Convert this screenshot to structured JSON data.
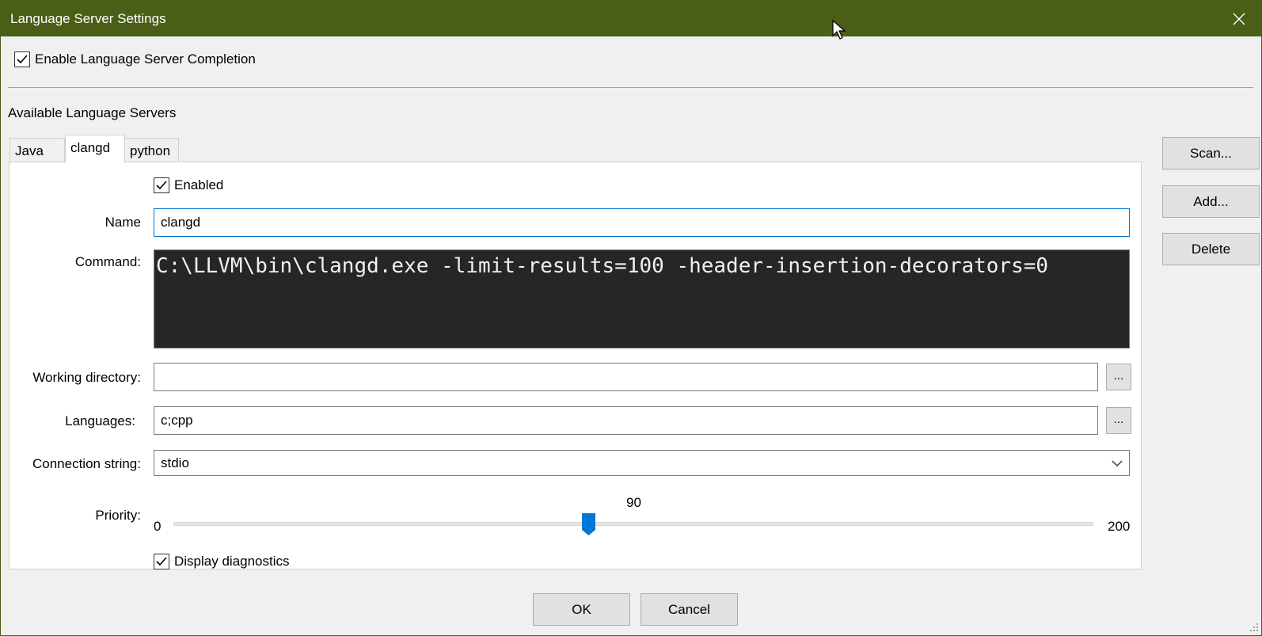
{
  "window": {
    "title": "Language Server Settings"
  },
  "enable_completion": {
    "label": "Enable Language Server Completion",
    "checked": true
  },
  "section_label": "Available Language Servers",
  "tabs": [
    {
      "label": "Java",
      "active": false
    },
    {
      "label": "clangd",
      "active": true
    },
    {
      "label": "python",
      "active": false
    }
  ],
  "form": {
    "enabled": {
      "label": "Enabled",
      "checked": true
    },
    "name": {
      "label": "Name",
      "value": "clangd"
    },
    "command": {
      "label": "Command:",
      "value": "C:\\LLVM\\bin\\clangd.exe -limit-results=100 -header-insertion-decorators=0"
    },
    "working_directory": {
      "label": "Working directory:",
      "value": "",
      "browse": "..."
    },
    "languages": {
      "label": "Languages:",
      "value": "c;cpp",
      "browse": "..."
    },
    "connection_string": {
      "label": "Connection string:",
      "value": "stdio"
    },
    "priority": {
      "label": "Priority:",
      "min": "0",
      "max": "200",
      "value": "90",
      "fraction": 0.45
    },
    "display_diagnostics": {
      "label": "Display diagnostics",
      "checked": true
    }
  },
  "side_buttons": {
    "scan": "Scan...",
    "add": "Add...",
    "delete": "Delete"
  },
  "footer": {
    "ok": "OK",
    "cancel": "Cancel"
  },
  "colors": {
    "titlebar": "#4a5e16",
    "accent": "#0078d7",
    "command_bg": "#262626"
  }
}
